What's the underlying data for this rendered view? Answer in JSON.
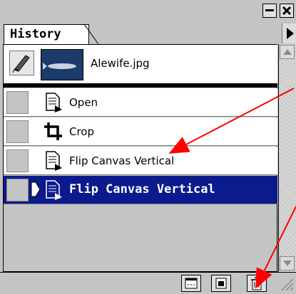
{
  "panel": {
    "tab_label": "History",
    "snapshot": {
      "filename": "Alewife.jpg"
    },
    "rows": [
      {
        "label": "Open",
        "icon": "document-icon",
        "selected": false
      },
      {
        "label": "Crop",
        "icon": "crop-icon",
        "selected": false
      },
      {
        "label": "Flip Canvas Vertical",
        "icon": "document-icon",
        "selected": false
      },
      {
        "label": "Flip Canvas Vertical",
        "icon": "document-icon",
        "selected": true
      }
    ],
    "bottom_buttons": [
      "new-document-button",
      "new-snapshot-button",
      "delete-button"
    ]
  },
  "colors": {
    "selection": "#0b1a8c",
    "annotation": "#ff0000",
    "panel_bg": "#c4c4c4"
  }
}
